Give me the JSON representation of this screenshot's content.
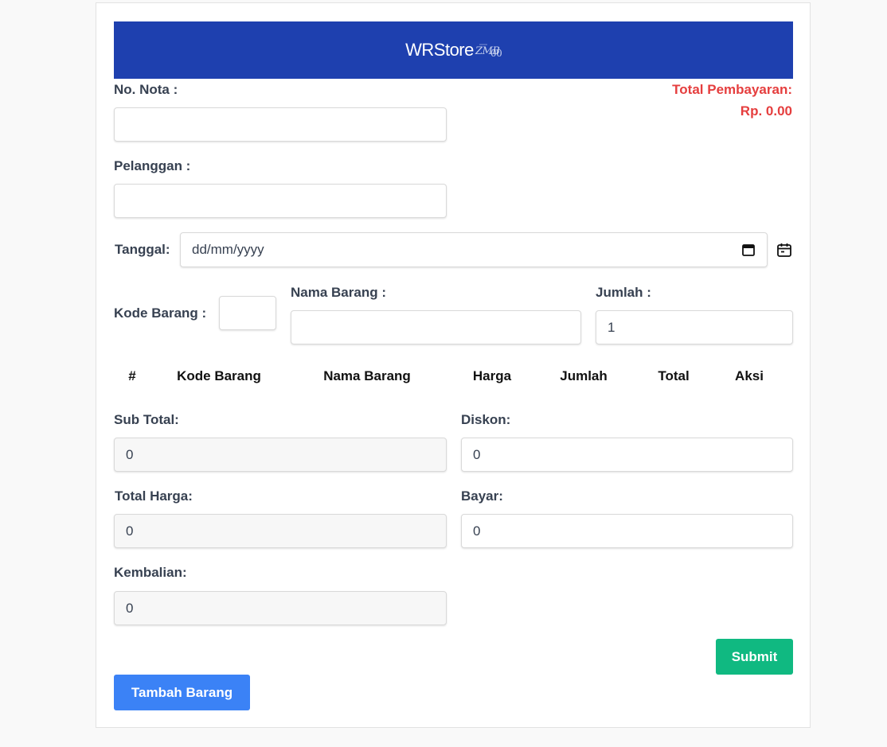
{
  "header": {
    "brand": "WRStore"
  },
  "form": {
    "no_nota": {
      "label": "No. Nota :",
      "value": ""
    },
    "pelanggan": {
      "label": "Pelanggan :",
      "value": ""
    },
    "tanggal": {
      "label": "Tanggal:",
      "placeholder": "dd/mm/yyyy"
    },
    "kode_barang": {
      "label": "Kode Barang :",
      "value": ""
    },
    "nama_barang": {
      "label": "Nama Barang :",
      "value": ""
    },
    "jumlah": {
      "label": "Jumlah :",
      "value": "1"
    }
  },
  "total_pembayaran": {
    "label": "Total Pembayaran:",
    "value": "Rp. 0.00",
    "color": "#e53e3e"
  },
  "table": {
    "columns": [
      "#",
      "Kode Barang",
      "Nama Barang",
      "Harga",
      "Jumlah",
      "Total",
      "Aksi"
    ],
    "rows": []
  },
  "summary": {
    "sub_total": {
      "label": "Sub Total:",
      "value": "0"
    },
    "diskon": {
      "label": "Diskon:",
      "value": "0"
    },
    "total_harga": {
      "label": "Total Harga:",
      "value": "0"
    },
    "bayar": {
      "label": "Bayar:",
      "value": "0"
    },
    "kembalian": {
      "label": "Kembalian:",
      "value": "0"
    }
  },
  "buttons": {
    "submit": "Submit",
    "tambah_barang": "Tambah Barang"
  },
  "colors": {
    "header_bg": "#1e40af",
    "submit_bg": "#10b981",
    "add_bg": "#3b82f6"
  },
  "icons": {
    "date_picker": "calendar-icon",
    "date_extra": "calendar-icon"
  }
}
